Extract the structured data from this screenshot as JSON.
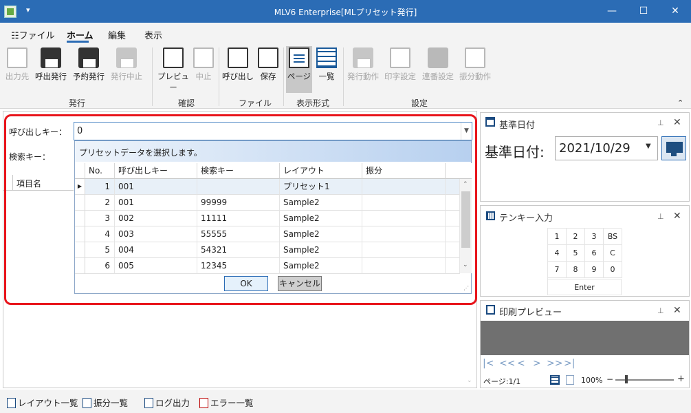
{
  "window": {
    "title": "MLV6 Enterprise[MLプリセット発行]",
    "qa_arrow": "▾",
    "min": "—",
    "max": "☐",
    "close": "✕"
  },
  "tabs": [
    {
      "label": "ファイル",
      "icon": "☷"
    },
    {
      "label": "ホーム"
    },
    {
      "label": "編集"
    },
    {
      "label": "表示"
    }
  ],
  "ribbon": {
    "buttons": [
      "出力先",
      "呼出発行",
      "予約発行",
      "発行中止",
      "プレビュー",
      "中止",
      "呼び出し",
      "保存",
      "ページ",
      "一覧",
      "発行動作",
      "印字設定",
      "連番設定",
      "振分動作"
    ],
    "groups": [
      "発行",
      "確認",
      "ファイル",
      "表示形式",
      "設定"
    ],
    "collapse": "⌃"
  },
  "form": {
    "callkey_label": "呼び出しキー：",
    "callkey_value": "0",
    "search_label": "検索キー：",
    "item_column": "項目名"
  },
  "popup": {
    "message": "プリセットデータを選択します。",
    "columns": [
      "No.",
      "呼び出しキー",
      "検索キー",
      "レイアウト",
      "振分"
    ],
    "rows": [
      {
        "no": "1",
        "callkey": "001",
        "search": "",
        "layout": "プリセット1",
        "dist": ""
      },
      {
        "no": "2",
        "callkey": "001",
        "search": "99999",
        "layout": "Sample2",
        "dist": ""
      },
      {
        "no": "3",
        "callkey": "002",
        "search": "11111",
        "layout": "Sample2",
        "dist": ""
      },
      {
        "no": "4",
        "callkey": "003",
        "search": "55555",
        "layout": "Sample2",
        "dist": ""
      },
      {
        "no": "5",
        "callkey": "004",
        "search": "54321",
        "layout": "Sample2",
        "dist": ""
      },
      {
        "no": "6",
        "callkey": "005",
        "search": "12345",
        "layout": "Sample2",
        "dist": ""
      }
    ],
    "ok": "OK",
    "cancel": "キャンセル",
    "current_row_marker": "▶"
  },
  "base_date": {
    "title": "基準日付",
    "label": "基準日付:",
    "value": "2021/10/29",
    "pin": "⊥",
    "close": "✕"
  },
  "tenkey": {
    "title": "テンキー入力",
    "keys": [
      [
        "1",
        "2",
        "3",
        "BS"
      ],
      [
        "4",
        "5",
        "6",
        "C"
      ],
      [
        "7",
        "8",
        "9",
        "0"
      ]
    ],
    "enter": "Enter",
    "pin": "⊥",
    "close": "✕"
  },
  "print_preview": {
    "title": "印刷プレビュー",
    "page_info": "ページ:1/1",
    "zoom": "100%",
    "nav": [
      "|<",
      "<<",
      "<",
      ">",
      ">>",
      ">|"
    ],
    "minus": "−",
    "plus": "+",
    "pin": "⊥",
    "close": "✕"
  },
  "bottom": {
    "items": [
      "レイアウト一覧",
      "振分一覧",
      "ログ出力",
      "エラー一覧"
    ]
  }
}
